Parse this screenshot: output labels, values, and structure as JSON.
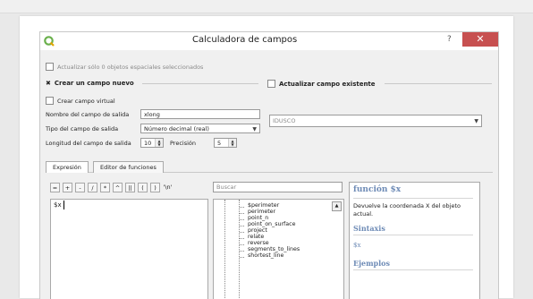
{
  "window": {
    "title": "Calculadora de campos",
    "help_glyph": "?",
    "close_glyph": "✕"
  },
  "options": {
    "update_selected_label": "Actualizar sólo 0 objetos espaciales seleccionados",
    "create_new_field_label": "Crear un campo nuevo",
    "create_new_field_mark": "✖",
    "update_existing_field_label": "Actualizar campo existente",
    "create_virtual_field_label": "Crear campo virtual"
  },
  "output": {
    "field_name_label": "Nombre del campo de salida",
    "field_name_value": "xlong",
    "field_type_label": "Tipo del campo de salida",
    "field_type_value": "Número decimal (real)",
    "field_length_label": "Longitud del campo de salida",
    "field_length_value": "10",
    "precision_label": "Precisión",
    "precision_value": "5",
    "existing_field_value": "IDUSCO"
  },
  "tabs": [
    {
      "label": "Expresión"
    },
    {
      "label": "Editor de funciones"
    }
  ],
  "operators": [
    "=",
    "+",
    "-",
    "/",
    "*",
    "^",
    "||",
    "(",
    ")",
    "'\\n'"
  ],
  "expression": {
    "value": "$x"
  },
  "search": {
    "placeholder": "Buscar"
  },
  "function_list": [
    "$perimeter",
    "perimeter",
    "point_n",
    "point_on_surface",
    "project",
    "relate",
    "reverse",
    "segments_to_lines",
    "shortest_line"
  ],
  "help": {
    "title": "función $x",
    "description": "Devuelve la coordenada X del objeto actual.",
    "syntax_heading": "Sintaxis",
    "syntax_value": "$x",
    "examples_heading": "Ejemplos"
  }
}
